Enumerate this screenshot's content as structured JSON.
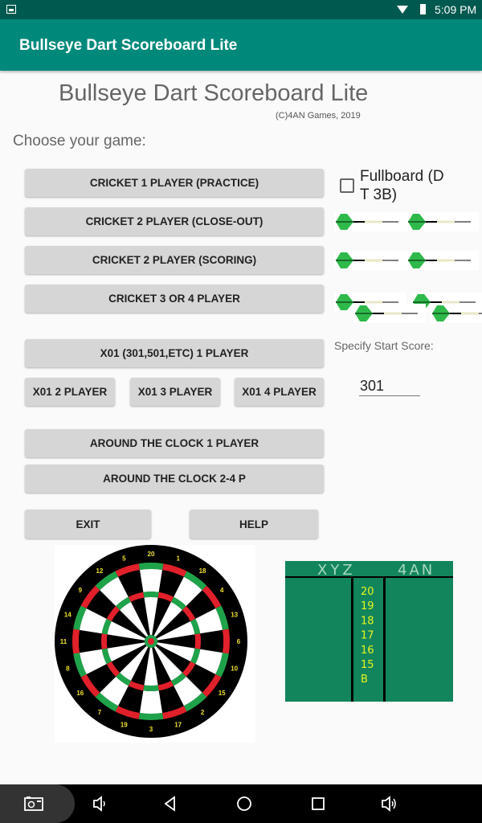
{
  "status_bar": {
    "time": "5:09 PM",
    "icons": [
      "image-notification-icon",
      "wifi-icon",
      "battery-icon"
    ]
  },
  "app_bar": {
    "title": "Bullseye Dart Scoreboard Lite"
  },
  "header": {
    "title": "Bullseye Dart Scoreboard Lite",
    "copyright": "(C)4AN Games, 2019",
    "prompt": "Choose your game:"
  },
  "cricket_buttons": [
    {
      "label": "CRICKET 1 PLAYER (PRACTICE)"
    },
    {
      "label": "CRICKET 2 PLAYER (CLOSE-OUT)"
    },
    {
      "label": "CRICKET 2 PLAYER (SCORING)"
    },
    {
      "label": "CRICKET 3 OR 4 PLAYER"
    }
  ],
  "fullboard": {
    "label": "Fullboard (D T 3B)",
    "checked": false
  },
  "dart_icons": {
    "row1": 2,
    "row2": 2,
    "row3": 4,
    "flight_color": "#2eb94a"
  },
  "x01": {
    "one_player_label": "X01 (301,501,ETC) 1 PLAYER",
    "two_player_label": "X01 2 PLAYER",
    "three_player_label": "X01 3 PLAYER",
    "four_player_label": "X01 4 PLAYER",
    "start_score_label": "Specify Start Score:",
    "start_score_value": "301"
  },
  "around_the_clock": {
    "one_player_label": "AROUND THE CLOCK 1 PLAYER",
    "multi_player_label": "AROUND THE CLOCK 2-4 P"
  },
  "footer_buttons": {
    "exit_label": "EXIT",
    "help_label": "HELP"
  },
  "dartboard": {
    "numbers": [
      "20",
      "1",
      "18",
      "4",
      "13",
      "6",
      "10",
      "15",
      "2",
      "17",
      "3",
      "19",
      "7",
      "16",
      "8",
      "11",
      "14",
      "9",
      "12",
      "5"
    ]
  },
  "chalkboard": {
    "player1": "XYZ",
    "player2": "4AN",
    "targets": [
      "20",
      "19",
      "18",
      "17",
      "16",
      "15",
      "B"
    ],
    "background": "#13855c",
    "target_color": "#e6f51f"
  },
  "nav_bar": {
    "icons": [
      "screenshot-icon",
      "volume-down-icon",
      "back-icon",
      "home-icon",
      "recents-icon",
      "volume-up-icon"
    ]
  },
  "colors": {
    "primary": "#00897b",
    "primary_dark": "#00594e",
    "button": "#d6d6d6"
  }
}
